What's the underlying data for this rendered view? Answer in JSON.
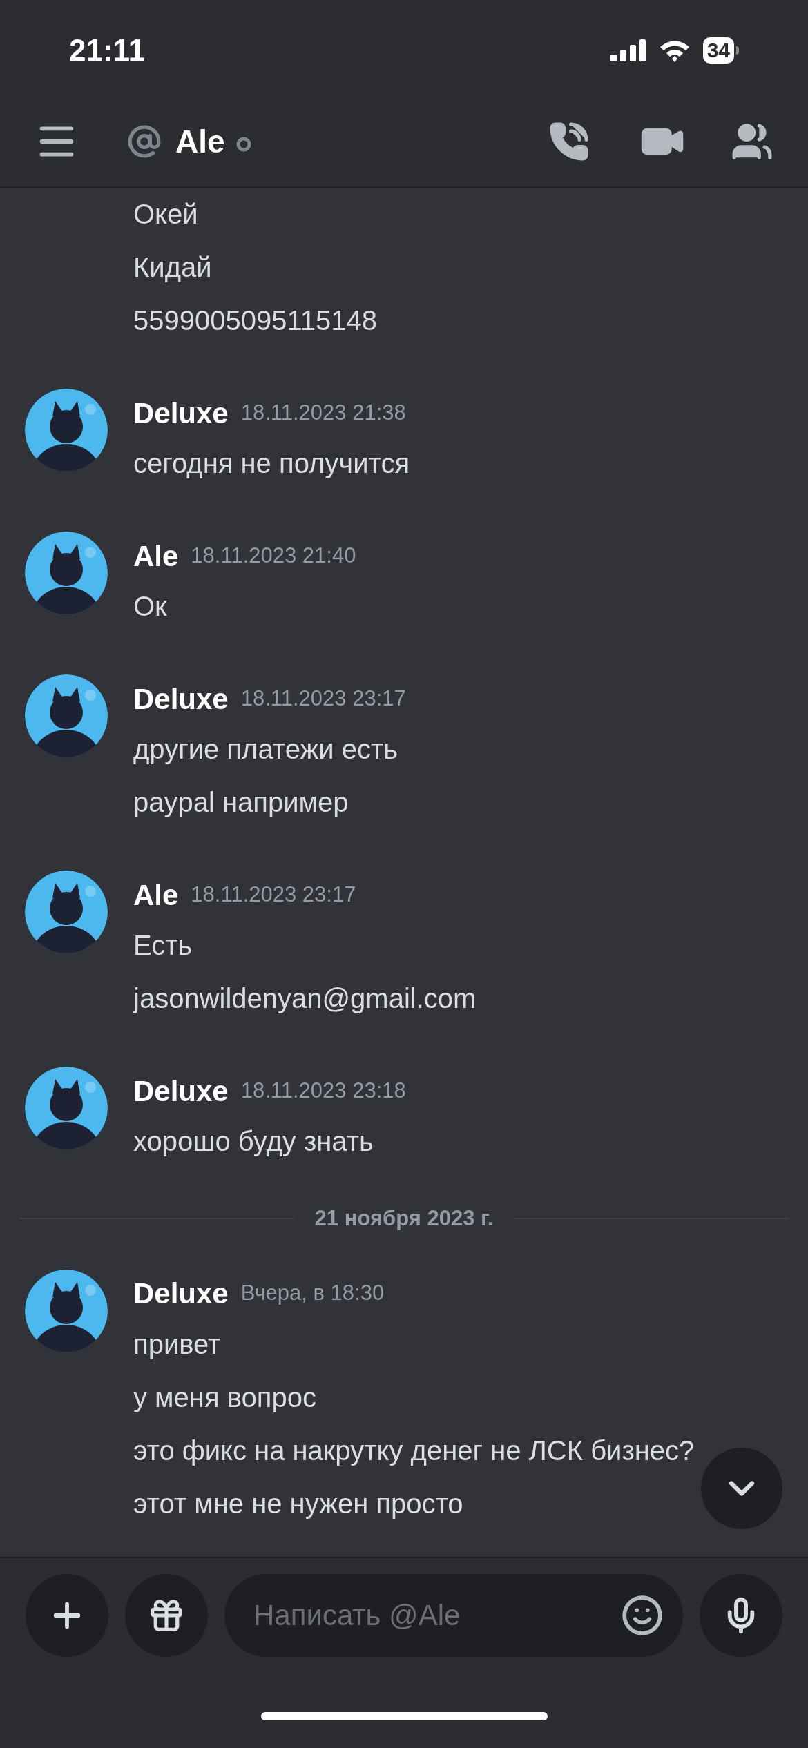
{
  "status_bar": {
    "time": "21:11",
    "battery": "34"
  },
  "header": {
    "title": "Ale"
  },
  "messages": [
    {
      "kind": "continuation",
      "lines": [
        "Окей",
        "Кидай",
        "5599005095115148"
      ]
    },
    {
      "kind": "group",
      "author": "Deluxe",
      "timestamp": "18.11.2023 21:38",
      "lines": [
        "сегодня не получится"
      ]
    },
    {
      "kind": "group",
      "author": "Ale",
      "timestamp": "18.11.2023 21:40",
      "lines": [
        "Ок"
      ]
    },
    {
      "kind": "group",
      "author": "Deluxe",
      "timestamp": "18.11.2023 23:17",
      "lines": [
        "другие платежи есть",
        "paypal например"
      ]
    },
    {
      "kind": "group",
      "author": "Ale",
      "timestamp": "18.11.2023 23:17",
      "lines": [
        "Есть",
        "jasonwildenyan@gmail.com"
      ]
    },
    {
      "kind": "group",
      "author": "Deluxe",
      "timestamp": "18.11.2023 23:18",
      "lines": [
        "хорошо буду знать"
      ]
    },
    {
      "kind": "divider",
      "label": "21 ноября 2023 г."
    },
    {
      "kind": "group",
      "author": "Deluxe",
      "timestamp": "Вчера, в 18:30",
      "lines": [
        "привет",
        "у меня вопрос",
        "это фикс на накрутку денег не ЛСК бизнес?",
        "этот мне не нужен просто"
      ]
    }
  ],
  "composer": {
    "placeholder": "Написать @Ale"
  }
}
